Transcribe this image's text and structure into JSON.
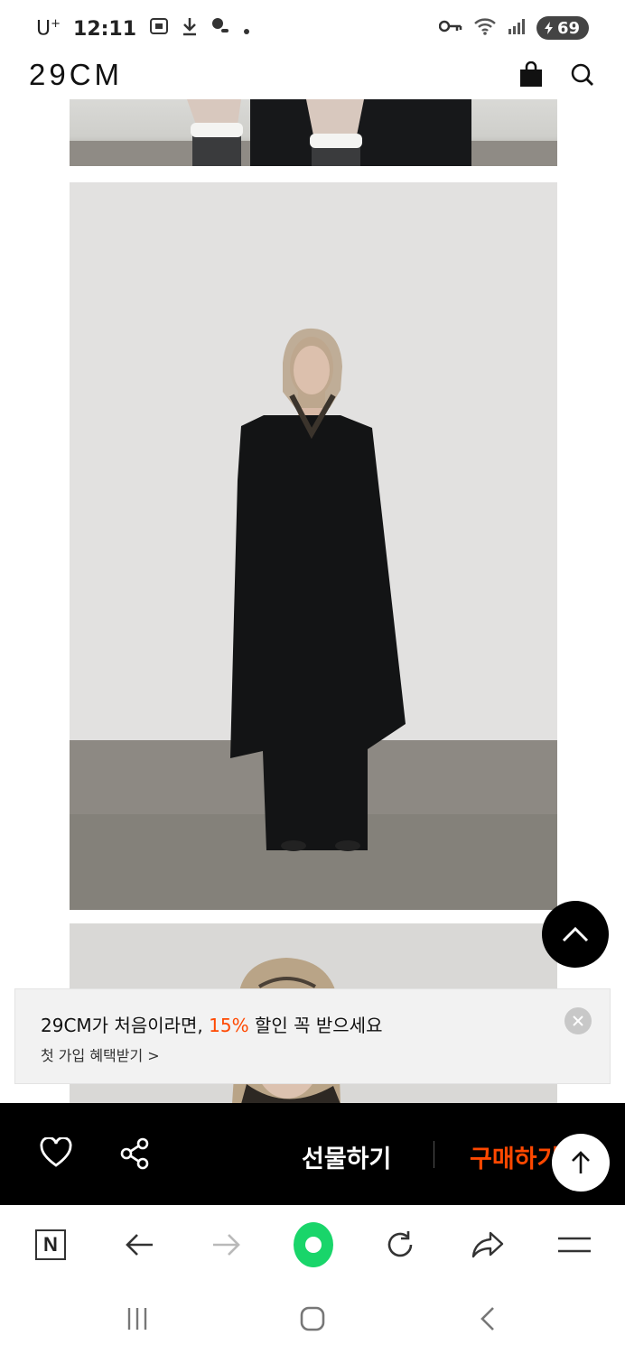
{
  "status_bar": {
    "carrier": "U",
    "carrier_sup": "+",
    "time": "12:11",
    "battery": "69",
    "icons": [
      "screenshot-icon",
      "download-icon",
      "location-icon",
      "dot-icon",
      "key-icon",
      "wifi-icon",
      "signal-icon",
      "battery-icon"
    ]
  },
  "header": {
    "logo": "29CM",
    "icons": [
      "shopping-bag-icon",
      "search-icon"
    ]
  },
  "promo": {
    "title_prefix": "29CM가 처음이라면, ",
    "title_accent": "15%",
    "title_suffix": " 할인 꼭 받으세요",
    "subtitle": "첫 가입 혜택받기 >",
    "accent_color": "#ff4800"
  },
  "buy_bar": {
    "gift_label": "선물하기",
    "buy_label": "구매하기",
    "icons": [
      "heart-icon",
      "share-icon"
    ]
  },
  "browser_toolbar": {
    "n_label": "N",
    "icons": [
      "naver-n-icon",
      "back-arrow-icon",
      "forward-arrow-icon",
      "green-circle-icon",
      "refresh-icon",
      "share-arrow-icon",
      "menu-icon"
    ]
  },
  "nav_bar": {
    "icons": [
      "recent-apps-icon",
      "home-icon",
      "back-icon"
    ]
  }
}
